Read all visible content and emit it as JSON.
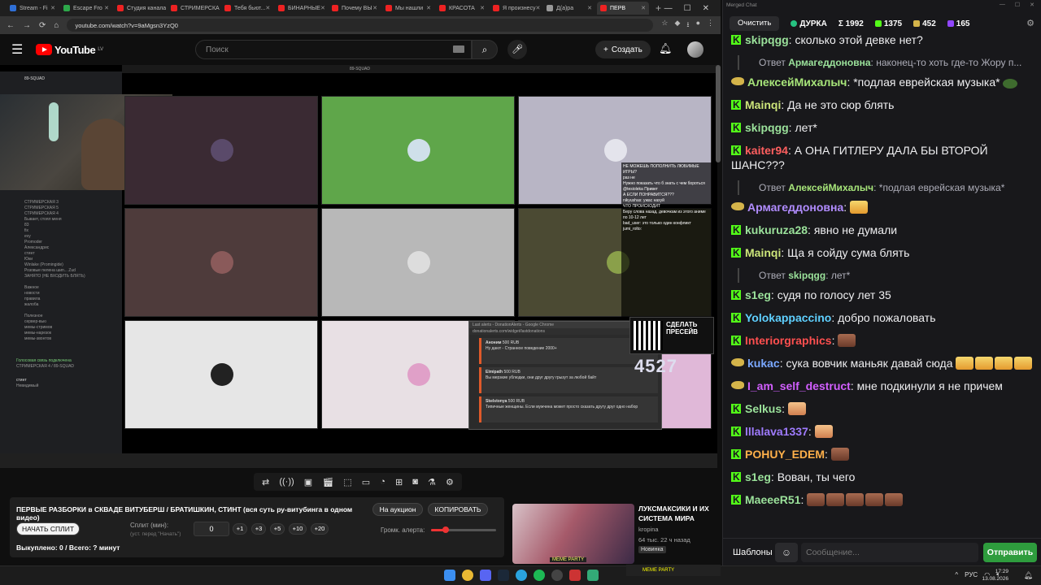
{
  "browser": {
    "tabs": [
      {
        "label": "Stream - Fi",
        "color": "#2f6fd6"
      },
      {
        "label": "Escape Fro",
        "color": "#2da84a"
      },
      {
        "label": "Студия канала",
        "color": "#e22"
      },
      {
        "label": "СТРИМЕРСКАЯ",
        "color": "#e22"
      },
      {
        "label": "Тебя бьют...",
        "color": "#e22"
      },
      {
        "label": "БИНАРНЫЕ",
        "color": "#e22"
      },
      {
        "label": "Почему ВЫ",
        "color": "#e22"
      },
      {
        "label": "Мы нашли",
        "color": "#e22"
      },
      {
        "label": "КРАСОТА",
        "color": "#e22"
      },
      {
        "label": "Я произнесу",
        "color": "#e22"
      },
      {
        "label": "Д(а)ра",
        "color": "#999"
      },
      {
        "label": "ПЕРВ",
        "color": "#e22",
        "active": true
      }
    ],
    "new_tab": "+",
    "url": "youtube.com/watch?v=9aMgsn3YzQ0",
    "win_buttons": [
      "—",
      "☐",
      "✕"
    ]
  },
  "youtube": {
    "logo_text": "YouTube",
    "logo_region": "LV",
    "search_placeholder": "Поиск",
    "create_label": "Создать"
  },
  "video": {
    "top_strip": "89-SQUAD",
    "discord": {
      "server": "89-SQUAD",
      "rows": [
        "СТРИМЕРСКАЯ 3",
        "СТРИМЕРСКАЯ 5",
        "СТРИМЕРСКАЯ 4",
        "Бывает, стоял меня",
        "83",
        "fix",
        "evy",
        "Promoder",
        "Александрис",
        "стинт",
        "Юки",
        "Winlake (Promingide)",
        "Розовые пелена шип... Zud",
        "ЗАНЯТО (НЕ ВХОДИТЬ БЛЯТЬ)",
        "",
        "Важное",
        "новости",
        "правила",
        "жалоба",
        "",
        "Полезное",
        "сервер-вью",
        "мемы-стримов",
        "мемы-нарезок",
        "мемы-звонтов"
      ],
      "status": "Голосовая связь подключена",
      "status_sub": "СТРИМЕРСКАЯ 4 / 89-SQUAD",
      "user": "стинт",
      "user_sub": "Невидимый"
    },
    "overlay_lines": [
      "НЕ МОЖЕШЬ ПОПОЛНИТЬ ЛЮБИМЫЕ ИГРЫ?",
      "раз не",
      "Нужно показать что б знать с чем бороться",
      "@tesioleka Привет",
      "А ЕСЛИ ПОНРАВИТСЯ???",
      "nikyushas: ужас нахуй",
      "ЧТО ПРОИСХОДИТ",
      "Беру слова назад, девочкам из этого аниме по 10-12 лет",
      "bad_user: это только один конфликт",
      "jumi_rolto:"
    ],
    "qr_text": [
      "СДЕЛАТЬ",
      "ПРЕСЕЙВ"
    ],
    "counter": "4527",
    "alerts": {
      "window_title": "Last alerts - DonationAlerts - Google Chrome",
      "url": "donationalerts.com/widget/lastdonations",
      "items": [
        {
          "name": "Аноним",
          "amount": "500 RUB",
          "text": "Ну дают - Странное поведение 2000+"
        },
        {
          "name": "Elmipath",
          "amount": "500 RUB",
          "text": "Вы мерзкие ублюдки, они друг другу грызут за любой байт"
        },
        {
          "name": "Skelstonya",
          "amount": "500 RUB",
          "text": "Типичные женщины. Если мужчина может просто сказать другу друг одно набор"
        }
      ]
    }
  },
  "toolbar_icons": [
    "shuffle-icon",
    "broadcast-icon",
    "camera-record-icon",
    "clapper-icon",
    "fullscreen-frame-icon",
    "theater-icon",
    "speed-icon",
    "add-clip-icon",
    "screenshot-icon",
    "flask-icon",
    "settings-icon"
  ],
  "panel": {
    "title": "ПЕРВЫЕ РАЗБОРКИ в СКВАДЕ ВИТУБЕРШ / БРАТИШКИН, СТИНТ (вся суть ру-витубинга в одном видео)",
    "auction_label": "На аукцион",
    "copy_label": "КОПИРОВАТЬ",
    "start_label": "НАЧАТЬ СПЛИТ",
    "split_label": "Сплит (мин):",
    "split_sub": "(уст. перед \"Начать\")",
    "split_value": "0",
    "increments": [
      "+1",
      "+3",
      "+5",
      "+10",
      "+20"
    ],
    "alert_volume_label": "Громк. алерта:",
    "alert_volume": 0.22,
    "bought": "Выкуплено: 0 / Всего: ? минут"
  },
  "recommendation": {
    "title": "ЛУКСМАКСИКИ И ИХ СИСТЕМА МИРА",
    "channel": "kropina",
    "meta": "64 тыс.  22 ч назад",
    "badge": "Новинка",
    "thumb_caption": "MEME PARTY"
  },
  "chat": {
    "window_title": "Merged Chat",
    "clear_label": "Очистить",
    "stats": [
      {
        "label": "ДУРКА",
        "icon": "live-dot-icon"
      },
      {
        "label": "Σ 1992",
        "icon": ""
      },
      {
        "label": "1375",
        "icon": "kick-icon"
      },
      {
        "label": "452",
        "icon": "duck-icon"
      },
      {
        "label": "165",
        "icon": "twitch-icon"
      }
    ],
    "messages": [
      {
        "type": "msg",
        "platform": "kick",
        "user": "skipqgg",
        "color": "#9be29b",
        "text": "сколько этой девке нет?"
      },
      {
        "type": "reply",
        "prefix": "Ответ",
        "user": "Армагеддоновна",
        "color": "#9be29b",
        "text": "наконец-то хоть где-то Жору п..."
      },
      {
        "type": "msg",
        "platform": "duck",
        "user": "АлексейМихалыч",
        "color": "#a7e57a",
        "text": "*подлая еврейская музыка*",
        "emotes": [
          "frog"
        ]
      },
      {
        "type": "msg",
        "platform": "kick",
        "user": "Mainqi",
        "color": "#cce57a",
        "text": "Да не это сюр блять"
      },
      {
        "type": "msg",
        "platform": "kick",
        "user": "skipqgg",
        "color": "#9be29b",
        "text": "лет*"
      },
      {
        "type": "msg",
        "platform": "kick",
        "user": "kaiter94",
        "color": "#ff5f5f",
        "text": "А ОНА ГИТЛЕРУ ДАЛА БЫ ВТОРОЙ ШАНС???"
      },
      {
        "type": "reply",
        "prefix": "Ответ",
        "user": "АлексейМихалыч",
        "color": "#a7e57a",
        "text": "*подлая еврейская музыка*"
      },
      {
        "type": "msg",
        "platform": "duck",
        "user": "Армагеддоновна",
        "color": "#b18cff",
        "text": "",
        "emotes": [
          "laugh"
        ]
      },
      {
        "type": "msg",
        "platform": "kick",
        "user": "kukuruza28",
        "color": "#9be29b",
        "text": "явно не думали"
      },
      {
        "type": "msg",
        "platform": "kick",
        "user": "Mainqi",
        "color": "#cce57a",
        "text": "Ща я сойду сума блять"
      },
      {
        "type": "reply",
        "prefix": "Ответ",
        "user": "skipqgg",
        "color": "#9be29b",
        "text": "лет*"
      },
      {
        "type": "msg",
        "platform": "kick",
        "user": "s1eg",
        "color": "#9be29b",
        "text": "судя по голосу лет 35"
      },
      {
        "type": "msg",
        "platform": "kick",
        "user": "Yolokappaccino",
        "color": "#5fd0ff",
        "text": "добро пожаловать"
      },
      {
        "type": "msg",
        "platform": "kick",
        "user": "Interiorgraphics",
        "color": "#ff4f4f",
        "text": "",
        "emotes": [
          "brown"
        ]
      },
      {
        "type": "msg",
        "platform": "duck",
        "user": "kukac",
        "color": "#7aa8ff",
        "text": "сука вовчик маньяк давай сюда",
        "emotes": [
          "laugh",
          "laugh",
          "laugh",
          "laugh"
        ]
      },
      {
        "type": "msg",
        "platform": "duck",
        "user": "I_am_self_destruct",
        "color": "#d25fff",
        "text": "мне подкинули я не причем"
      },
      {
        "type": "msg",
        "platform": "kick",
        "user": "Selkus",
        "color": "#9be29b",
        "text": "",
        "emotes": [
          "face"
        ]
      },
      {
        "type": "msg",
        "platform": "kick",
        "user": "lllalava1337",
        "color": "#9f7bff",
        "text": "",
        "emotes": [
          "face"
        ]
      },
      {
        "type": "msg",
        "platform": "kick",
        "user": "POHUY_EDEM",
        "color": "#ffb04a",
        "text": "",
        "emotes": [
          "brown"
        ]
      },
      {
        "type": "msg",
        "platform": "kick",
        "user": "s1eg",
        "color": "#9be29b",
        "text": "Вован, ты чего"
      },
      {
        "type": "msg",
        "platform": "kick",
        "user": "MaeeeR51",
        "color": "#9be29b",
        "text": "",
        "emotes": [
          "brown",
          "brown",
          "brown",
          "brown",
          "brown"
        ]
      }
    ],
    "templates_label": "Шаблоны",
    "input_placeholder": "Сообщение...",
    "send_label": "Отправить"
  },
  "taskbar": {
    "tray_lang": "РУС",
    "time": "17:29",
    "date": "13.08.2026",
    "media_label": "MEME PARTY"
  }
}
